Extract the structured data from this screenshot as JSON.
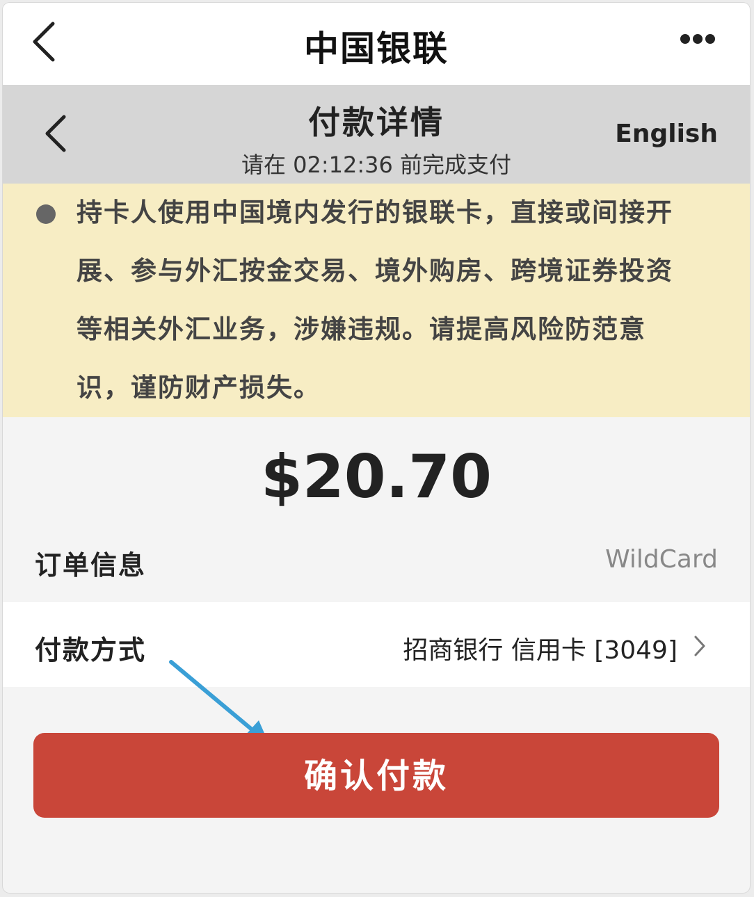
{
  "top_bar": {
    "title": "中国银联",
    "back_icon": "chevron-left-icon",
    "more_icon": "more-horizontal-icon"
  },
  "sub_header": {
    "title": "付款详情",
    "deadline": "请在 02:12:36 前完成支付",
    "language_toggle": "English",
    "back_icon": "chevron-left-icon"
  },
  "notice": {
    "lines": [
      "持卡人使用中国境内发行的银联卡，直接或间接开",
      "展、参与外汇按金交易、境外购房、跨境证券投资",
      "等相关外汇业务，涉嫌违规。请提高风险防范意",
      "识，谨防财产损失。"
    ],
    "bullet_color": "#666666",
    "background": "#f7edc4"
  },
  "payment": {
    "amount": "$20.70",
    "order_label": "订单信息",
    "order_value": "WildCard",
    "method_label": "付款方式",
    "method_value": "招商银行 信用卡 [3049]"
  },
  "confirm_button": {
    "label": "确认付款",
    "color": "#c94639"
  },
  "annotation": {
    "arrow_color": "#3a9fd6"
  }
}
